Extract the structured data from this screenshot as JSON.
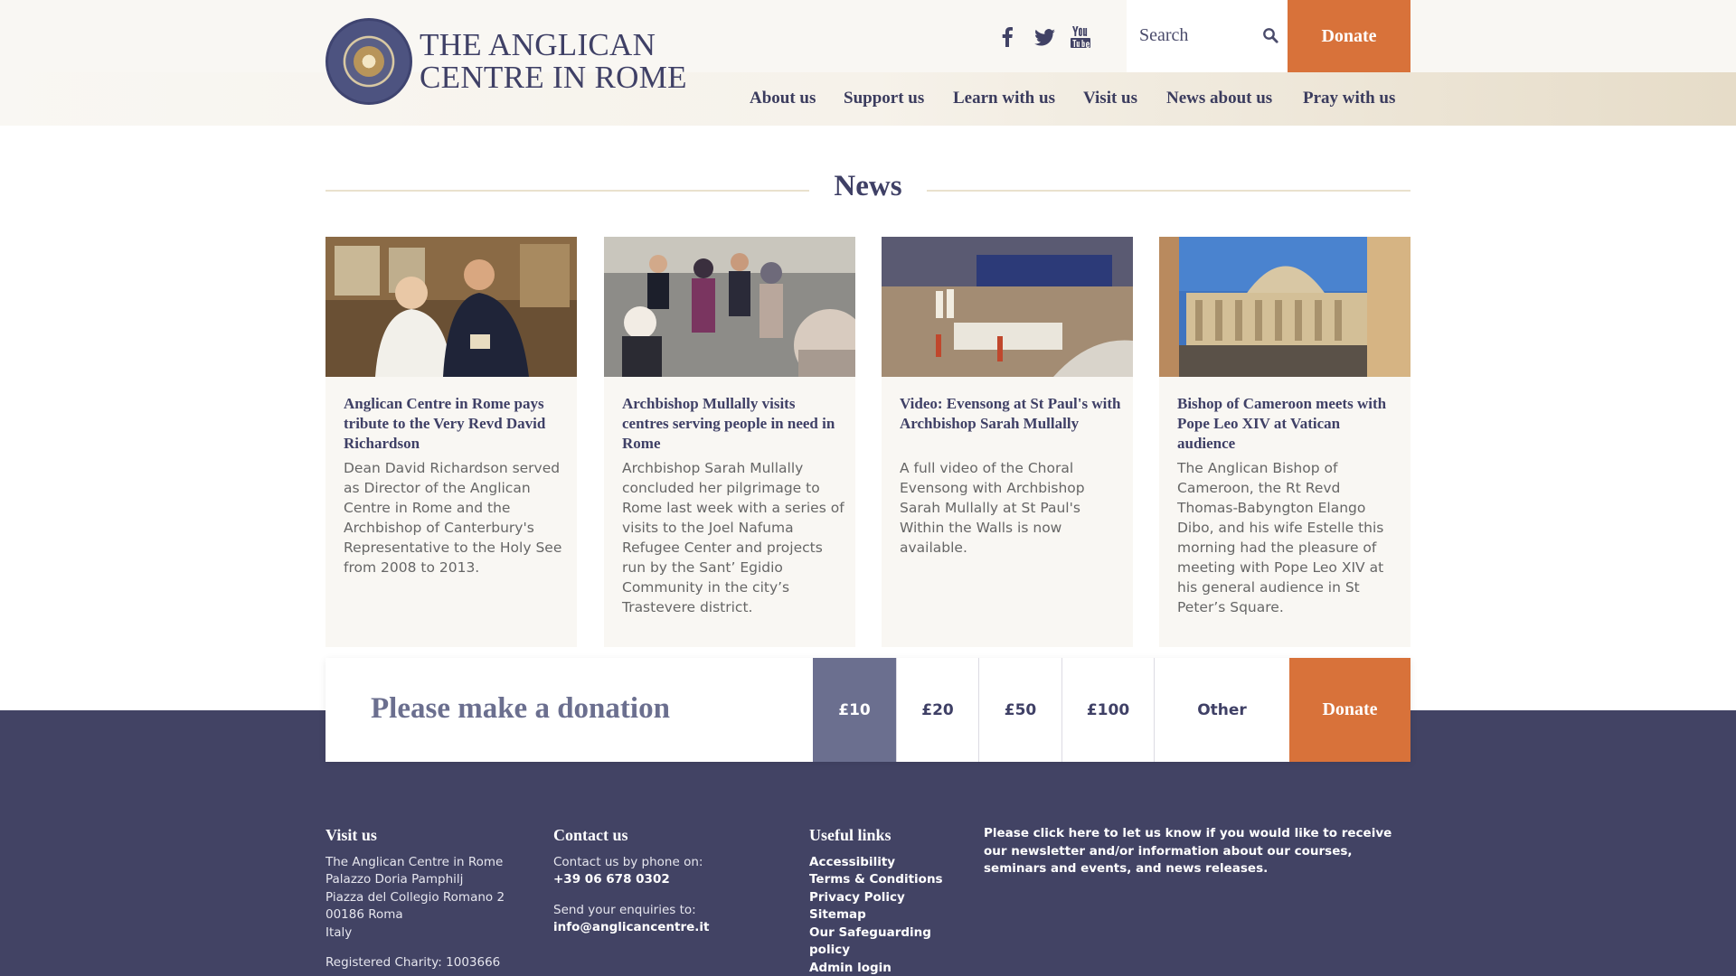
{
  "logo": {
    "line1": "THE ANGLICAN",
    "line2": "CENTRE IN ROME",
    "seal_text": "THE ANGLICAN CENTRE IN ROME"
  },
  "social": [
    "facebook-icon",
    "twitter-icon",
    "youtube-icon"
  ],
  "search": {
    "placeholder": "Search"
  },
  "header": {
    "donate_label": "Donate"
  },
  "nav": [
    "About us",
    "Support us",
    "Learn with us",
    "Visit us",
    "News about us",
    "Pray with us"
  ],
  "news": {
    "title": "News",
    "cards": [
      {
        "title": "Anglican Centre in Rome pays tribute to the Very Revd David Richardson",
        "excerpt": "Dean David Richardson served as Director of the Anglican Centre in Rome and the Archbishop of Canterbury's Representative to the Holy See from 2008 to 2013."
      },
      {
        "title": "Archbishop Mullally visits centres serving people in need in Rome",
        "excerpt": "Archbishop Sarah Mullally concluded her pilgrimage to Rome last week with a series of visits to the Joel Nafuma Refugee Center and projects run by the Sant’ Egidio Community in the city’s Trastevere district."
      },
      {
        "title": "Video: Evensong at St Paul's with Archbishop Sarah Mullally",
        "excerpt": "A full video of the Choral Evensong with Archbishop Sarah Mullally at St Paul's Within the Walls is now available."
      },
      {
        "title": "Bishop of Cameroon meets with Pope Leo XIV at Vatican audience",
        "excerpt": "The Anglican Bishop of Cameroon, the Rt Revd Thomas-Babyngton Elango Dibo, and his wife Estelle this morning had the pleasure of meeting with Pope Leo XIV at his general audience in St Peter’s Square."
      }
    ]
  },
  "donation": {
    "title": "Please make a donation",
    "amounts": [
      "£10",
      "£20",
      "£50",
      "£100",
      "Other"
    ],
    "selected": "£10",
    "donate_label": "Donate"
  },
  "footer": {
    "visit": {
      "title": "Visit us",
      "lines": [
        "The Anglican Centre in Rome",
        "Palazzo Doria Pamphilj",
        "Piazza del Collegio Romano 2",
        "00186 Roma",
        "Italy"
      ],
      "charity": "Registered Charity: 1003666"
    },
    "contact": {
      "title": "Contact us",
      "phone_label": "Contact us by phone on:",
      "phone": "+39 06 678 0302",
      "email_label": "Send your enquiries to:",
      "email": "info@anglicancentre.it"
    },
    "links": {
      "title": "Useful links",
      "items": [
        "Accessibility",
        "Terms & Conditions",
        "Privacy Policy",
        "Sitemap",
        "Our Safeguarding",
        "policy",
        "Admin login"
      ]
    },
    "newsletter": "Please click here to let us know if you would like to receive our newsletter and/or information about our courses, seminars and events, and news releases."
  },
  "colors": {
    "brand": "#424364",
    "accent": "#d8723a",
    "cream": "#f9f7f3",
    "selected": "#6b6f8f"
  }
}
